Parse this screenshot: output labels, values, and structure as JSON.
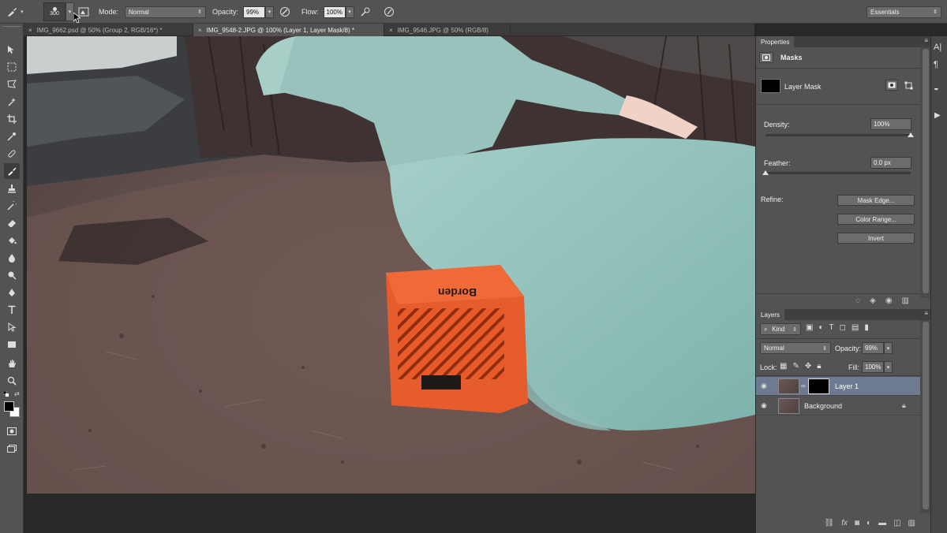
{
  "options_bar": {
    "brush_size": "300",
    "mode_label": "Mode:",
    "mode_value": "Normal",
    "opacity_label": "Opacity:",
    "opacity_value": "99%",
    "flow_label": "Flow:",
    "flow_value": "100%",
    "workspace": "Essentials"
  },
  "tabs": [
    {
      "label": "IMG_9662.psd @ 50% (Group 2, RGB/16*) *"
    },
    {
      "label": "IMG_9548-2.JPG @ 100% (Layer 1, Layer Mask/8) *"
    },
    {
      "label": "IMG_9546.JPG @ 50% (RGB/8)"
    }
  ],
  "properties": {
    "panel_title": "Properties",
    "section": "Masks",
    "mask_label": "Layer Mask",
    "density_label": "Density:",
    "density_value": "100%",
    "density": 1.0,
    "feather_label": "Feather:",
    "feather_value": "0.0 px",
    "feather": 0.0,
    "refine_label": "Refine:",
    "mask_edge_button": "Mask Edge...",
    "color_range_button": "Color Range...",
    "invert_button": "Invert"
  },
  "layers": {
    "panel_title": "Layers",
    "filter_kind": "Kind",
    "blend_mode": "Normal",
    "opacity_label": "Opacity:",
    "opacity_value": "99%",
    "lock_label": "Lock:",
    "fill_label": "Fill:",
    "fill_value": "100%",
    "items": [
      {
        "name": "Layer 1",
        "selected": true
      },
      {
        "name": "Background",
        "selected": false
      }
    ]
  },
  "colors": {
    "selected_row": "#6e7a92",
    "foreground": "#000000",
    "background": "#ffffff"
  }
}
